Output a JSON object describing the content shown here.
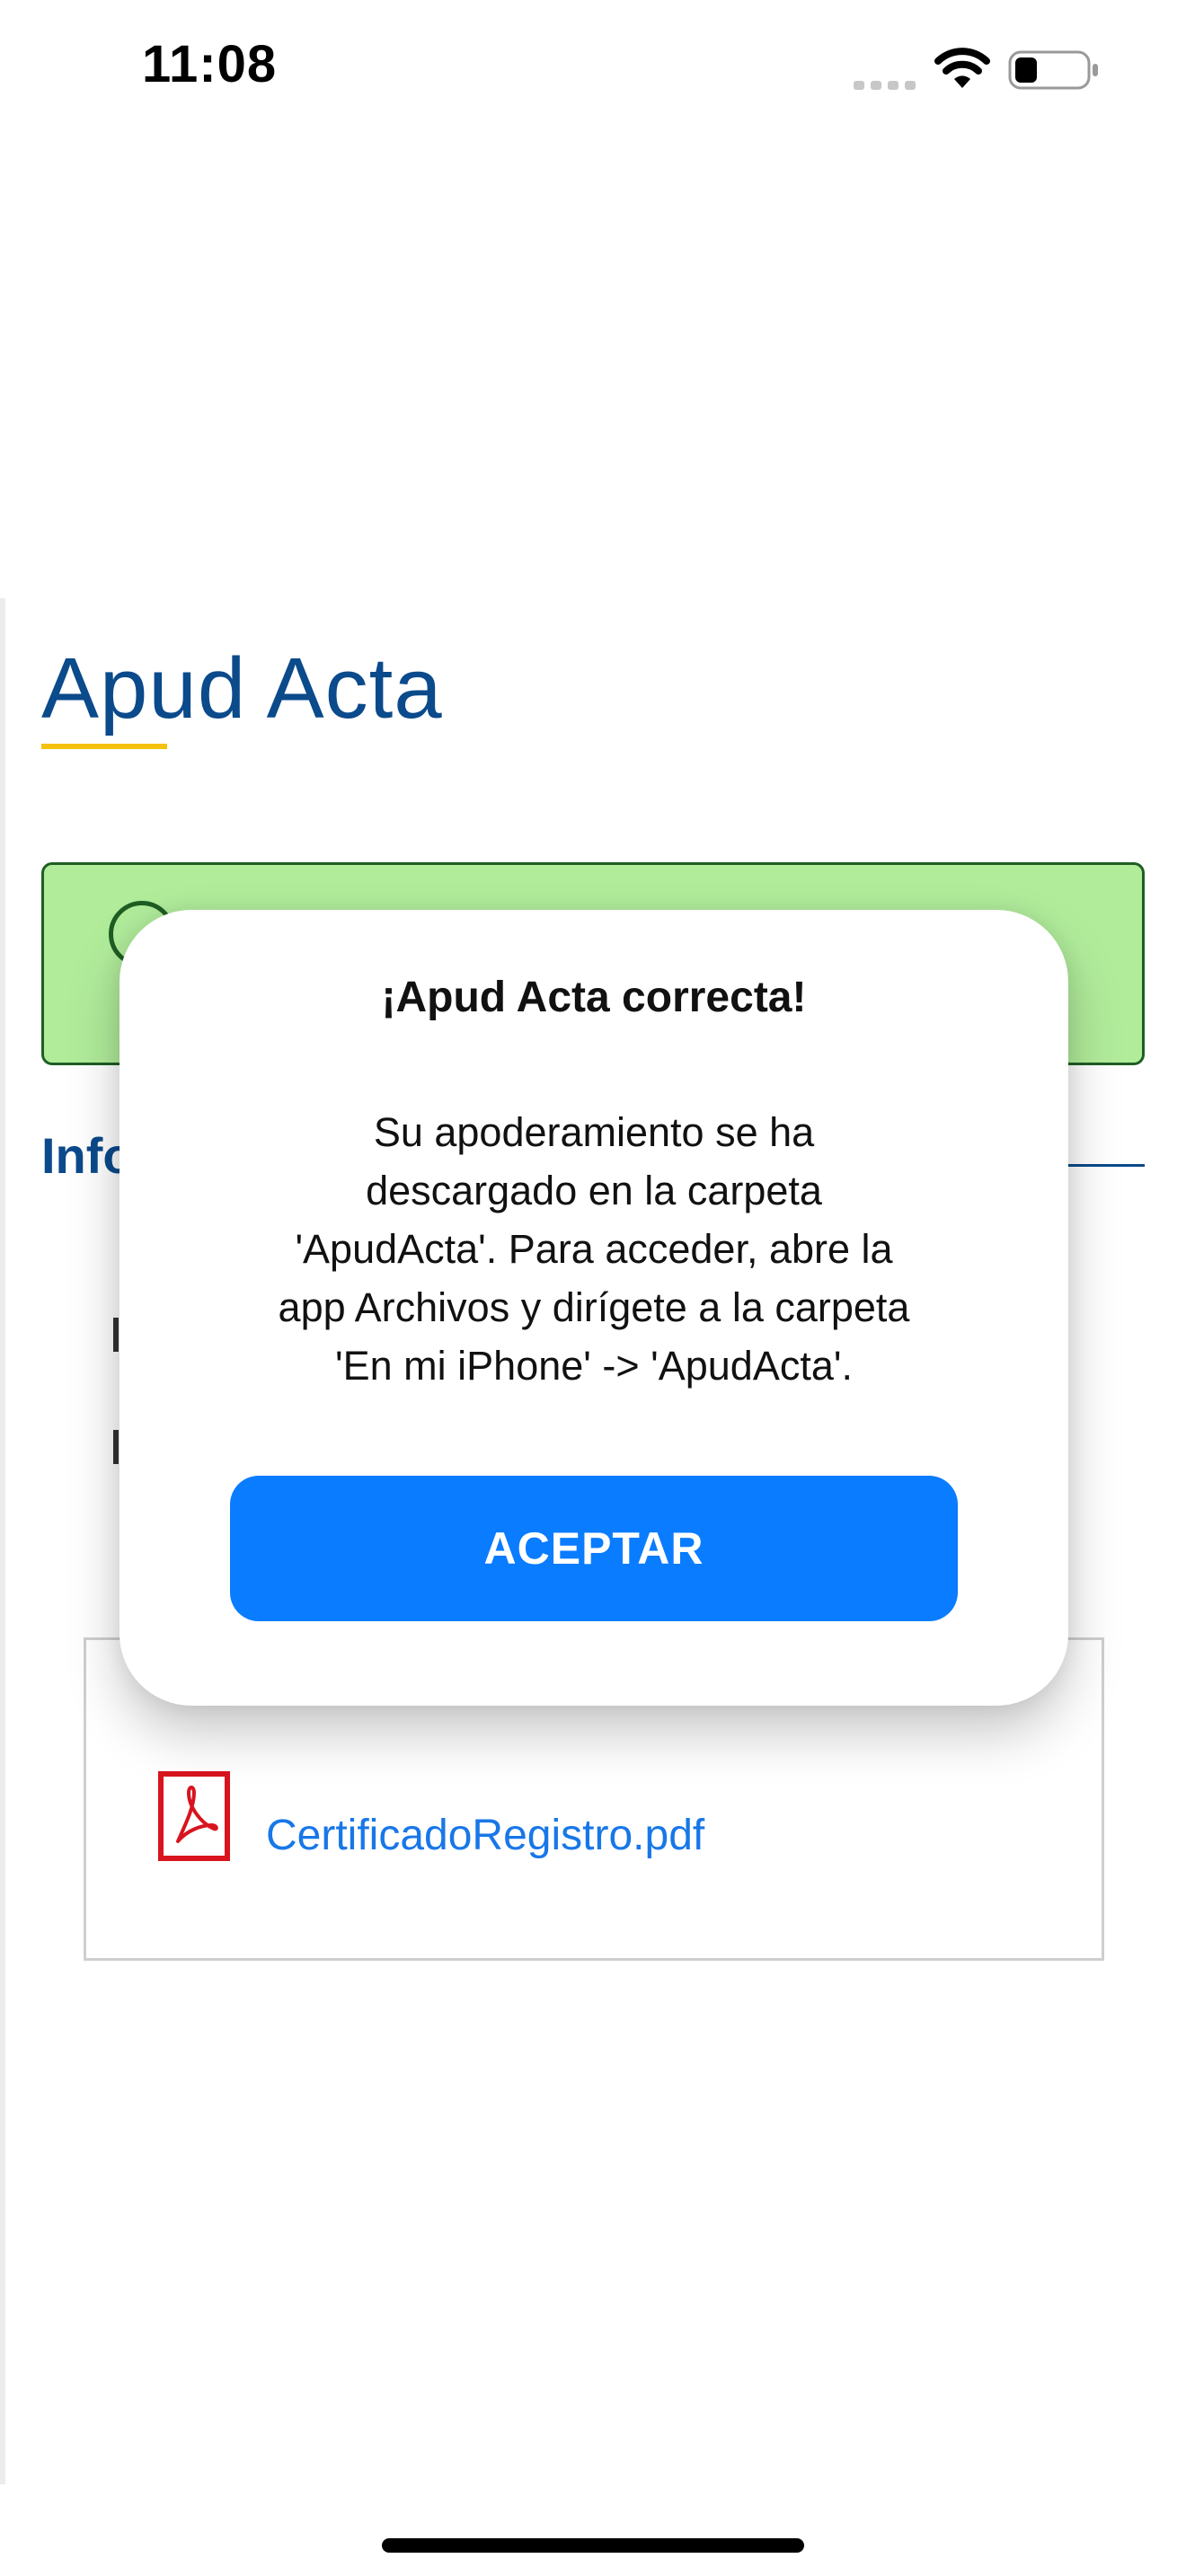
{
  "status_bar": {
    "time": "11:08",
    "icons": [
      "signal-icon",
      "wifi-icon",
      "battery-icon"
    ]
  },
  "page": {
    "title": "Apud Acta",
    "section_heading": "Info",
    "file": {
      "name": "CertificadoRegistro.pdf",
      "icon": "pdf-icon"
    }
  },
  "modal": {
    "title": "¡Apud Acta correcta!",
    "message_lines": [
      "Su apoderamiento se ha",
      "descargado en la carpeta",
      "'ApudActa'. Para acceder, abre la",
      "app Archivos y dirígete a la carpeta",
      "'En mi iPhone' -> 'ApudActa'."
    ],
    "accept_label": "ACEPTAR"
  },
  "colors": {
    "brand_blue": "#0b4a8b",
    "accent_yellow": "#f4c20d",
    "success_green_bg": "#b1ec9b",
    "success_green_border": "#1f5e23",
    "button_blue": "#0a7cff",
    "link_blue": "#1877e8",
    "pdf_red": "#d8141f"
  }
}
